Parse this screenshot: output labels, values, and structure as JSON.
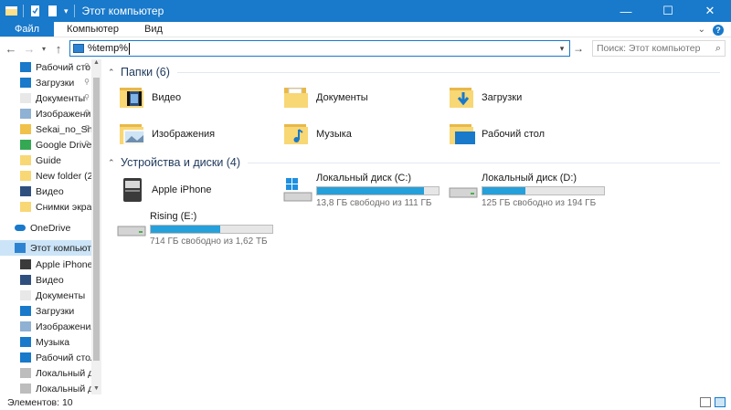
{
  "window": {
    "title": "Этот компьютер",
    "minimize": "—",
    "maximize": "☐",
    "close": "✕"
  },
  "ribbon": {
    "tabs": [
      {
        "label": "Файл",
        "active": true
      },
      {
        "label": "Компьютер",
        "active": false
      },
      {
        "label": "Вид",
        "active": false
      }
    ],
    "expand": "⌄",
    "help": "?"
  },
  "address": {
    "value": "%temp%",
    "dropdown": "▾",
    "go": "→"
  },
  "search": {
    "placeholder": "Поиск: Этот компьютер",
    "icon": "search-icon"
  },
  "nav": {
    "items": [
      {
        "label": "Рабочий сто.",
        "icon": "desktop-icon",
        "pinned": true
      },
      {
        "label": "Загрузки",
        "icon": "downloads-icon",
        "pinned": true
      },
      {
        "label": "Документы",
        "icon": "documents-icon",
        "pinned": true
      },
      {
        "label": "Изображени",
        "icon": "pictures-icon",
        "pinned": true
      },
      {
        "label": "Sekai_no_Shu",
        "icon": "sync-folder-icon",
        "pinned": true
      },
      {
        "label": "Google Drive",
        "icon": "google-drive-icon",
        "pinned": true
      },
      {
        "label": "Guide",
        "icon": "folder-icon",
        "pinned": false
      },
      {
        "label": "New folder (2)",
        "icon": "folder-icon",
        "pinned": false
      },
      {
        "label": "Видео",
        "icon": "videos-icon",
        "pinned": false
      },
      {
        "label": "Снимки экрана",
        "icon": "folder-icon",
        "pinned": false
      },
      {
        "label": "OneDrive",
        "icon": "onedrive-icon",
        "pinned": false
      },
      {
        "label": "Этот компьютер",
        "icon": "this-pc-icon",
        "pinned": false,
        "selected": true
      },
      {
        "label": "Apple iPhone",
        "icon": "phone-icon",
        "pinned": false
      },
      {
        "label": "Видео",
        "icon": "videos-icon",
        "pinned": false
      },
      {
        "label": "Документы",
        "icon": "documents-icon",
        "pinned": false
      },
      {
        "label": "Загрузки",
        "icon": "downloads-icon",
        "pinned": false
      },
      {
        "label": "Изображения",
        "icon": "pictures-icon",
        "pinned": false
      },
      {
        "label": "Музыка",
        "icon": "music-icon",
        "pinned": false
      },
      {
        "label": "Рабочий стол",
        "icon": "desktop-icon",
        "pinned": false
      },
      {
        "label": "Локальный дис",
        "icon": "drive-icon",
        "pinned": false
      },
      {
        "label": "Локальный дис",
        "icon": "drive-icon",
        "pinned": false
      }
    ],
    "pin_glyph": "📌"
  },
  "folders_group": {
    "title": "Папки (6)",
    "items": [
      {
        "label": "Видео",
        "icon": "videos-folder-icon"
      },
      {
        "label": "Документы",
        "icon": "documents-folder-icon"
      },
      {
        "label": "Загрузки",
        "icon": "downloads-folder-icon"
      },
      {
        "label": "Изображения",
        "icon": "pictures-folder-icon"
      },
      {
        "label": "Музыка",
        "icon": "music-folder-icon"
      },
      {
        "label": "Рабочий стол",
        "icon": "desktop-folder-icon"
      }
    ]
  },
  "devices_group": {
    "title": "Устройства и диски (4)",
    "items": [
      {
        "label": "Apple iPhone",
        "icon": "iphone-icon"
      },
      {
        "label": "Локальный диск (C:)",
        "icon": "windows-drive-icon",
        "free": "13,8 ГБ свободно из 111 ГБ",
        "used_fraction": 0.876
      },
      {
        "label": "Локальный диск (D:)",
        "icon": "drive-icon",
        "free": "125 ГБ свободно из 194 ГБ",
        "used_fraction": 0.356
      },
      {
        "label": "Rising (E:)",
        "icon": "drive-icon",
        "free": "714 ГБ свободно из 1,62 ТБ",
        "used_fraction": 0.57
      }
    ]
  },
  "status": {
    "count": "Элементов: 10"
  },
  "colors": {
    "accent": "#1979ca",
    "bar_fill": "#26a0da",
    "folder": "#f8d775"
  }
}
